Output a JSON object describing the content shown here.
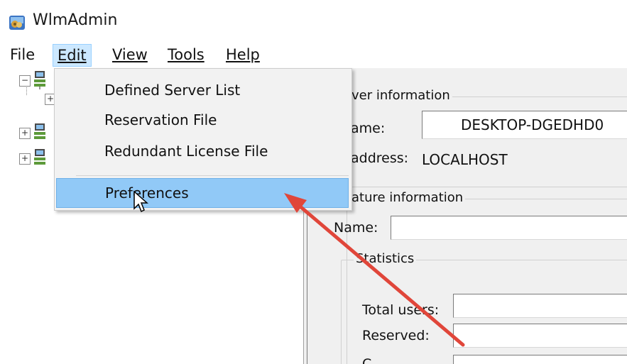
{
  "window": {
    "title": "WlmAdmin",
    "icon": "wlmadmin-app-icon"
  },
  "menubar": {
    "items": [
      {
        "label": "File",
        "accel": ""
      },
      {
        "label": "Edit",
        "accel": "E"
      },
      {
        "label": "View",
        "accel": "V"
      },
      {
        "label": "Tools",
        "accel": "T"
      },
      {
        "label": "Help",
        "accel": "H"
      }
    ],
    "open_menu": "Edit"
  },
  "edit_menu": {
    "items": [
      {
        "label": "Defined Server List"
      },
      {
        "label": "Reservation File"
      },
      {
        "label": "Redundant License File"
      },
      {
        "label": "Preferences",
        "selected": true
      }
    ]
  },
  "tree": {
    "nodes": [
      {
        "expander": "−",
        "icon": "server-network-icon"
      },
      {
        "expander": "+",
        "icon": ""
      },
      {
        "expander": "+",
        "icon": "server-network-icon"
      },
      {
        "expander": "+",
        "icon": "server-network-icon"
      }
    ]
  },
  "server_info": {
    "group_label": "ver information",
    "name_label": "ame:",
    "name_value": "DESKTOP-DGEDHD0",
    "address_label": "address:",
    "address_value": "LOCALHOST"
  },
  "feature_info": {
    "group_label": "ature information",
    "name_label": "Name:",
    "name_value": ""
  },
  "statistics": {
    "group_label": "Statistics",
    "total_users_label": "Total users:",
    "reserved_label": "Reserved:",
    "next_label": "C..."
  },
  "colors": {
    "menu_highlight": "#91c9f7",
    "menu_bar_active": "#cce8ff",
    "annotation_arrow": "#e0463a",
    "panel_bg": "#f0f0f0"
  }
}
